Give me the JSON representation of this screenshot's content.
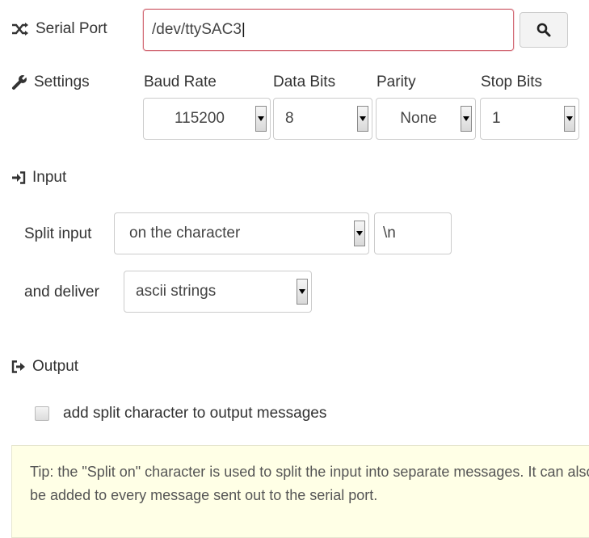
{
  "serial_port": {
    "label": "Serial Port",
    "value": "/dev/ttySAC3",
    "icon": "shuffle-icon",
    "search_icon": "search-icon"
  },
  "settings": {
    "label": "Settings",
    "icon": "wrench-icon",
    "baud_rate": {
      "label": "Baud Rate",
      "value": "115200"
    },
    "data_bits": {
      "label": "Data Bits",
      "value": "8"
    },
    "parity": {
      "label": "Parity",
      "value": "None"
    },
    "stop_bits": {
      "label": "Stop Bits",
      "value": "1"
    }
  },
  "input": {
    "label": "Input",
    "icon": "sign-in-icon",
    "split_label": "Split input",
    "split_value": "on the character",
    "split_char": "\\n",
    "deliver_label": "and deliver",
    "deliver_value": "ascii strings"
  },
  "output": {
    "label": "Output",
    "icon": "sign-out-icon",
    "checkbox_label": "add split character to output messages",
    "checked": false
  },
  "tip": {
    "text": "Tip: the \"Split on\" character is used to split the input into separate messages. It can also be added to every message sent out to the serial port."
  },
  "colors": {
    "focus_border": "#d36c77",
    "tip_background": "#ffffe6"
  }
}
